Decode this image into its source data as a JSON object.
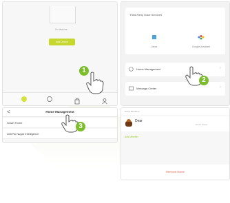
{
  "panel1": {
    "message": "No devices",
    "button_label": "Add Device"
  },
  "panel2": {
    "section_title": "Third-Party Voice Services",
    "services": [
      {
        "label": "Alexa"
      },
      {
        "label": "Google Assistant"
      }
    ],
    "rows": [
      {
        "label": "Home Management"
      },
      {
        "label": "Message Center"
      }
    ]
  },
  "panel3": {
    "back_icon": "<",
    "title": "Home Management",
    "rows": [
      {
        "label": "Smart Home"
      },
      {
        "label": "LinkPlu Nugar Intelligence"
      }
    ]
  },
  "panel4": {
    "header": "Home Members",
    "member_name": "Dear",
    "member_sub": "",
    "member_role": "Home Owner",
    "link_label": "Add Member",
    "remove_label": "Remove Home"
  },
  "steps": [
    "1",
    "2",
    "3"
  ],
  "colors": {
    "accent": "#c6d82d",
    "badge": "#7cbd2a",
    "danger": "#e05a4a"
  }
}
